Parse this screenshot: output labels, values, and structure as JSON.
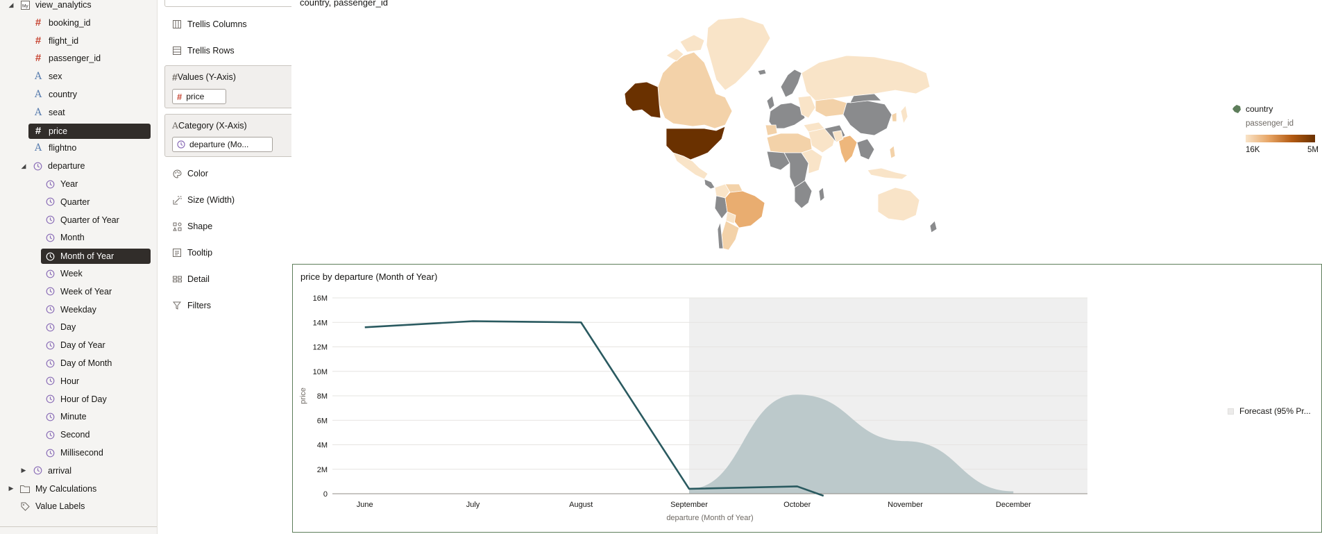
{
  "data_panel": {
    "root": {
      "label": "view_analytics",
      "icon": "database-icon"
    },
    "fields": [
      {
        "label": "booking_id",
        "type": "number"
      },
      {
        "label": "flight_id",
        "type": "number"
      },
      {
        "label": "passenger_id",
        "type": "number"
      },
      {
        "label": "sex",
        "type": "text"
      },
      {
        "label": "country",
        "type": "text"
      },
      {
        "label": "seat",
        "type": "text"
      },
      {
        "label": "price",
        "type": "number",
        "selected": true
      },
      {
        "label": "flightno",
        "type": "text"
      }
    ],
    "departure": {
      "label": "departure",
      "children": [
        "Year",
        "Quarter",
        "Quarter of Year",
        "Month",
        "Month of Year",
        "Week",
        "Week of Year",
        "Weekday",
        "Day",
        "Day of Year",
        "Day of Month",
        "Hour",
        "Hour of Day",
        "Minute",
        "Second",
        "Millisecond"
      ],
      "selected": "Month of Year"
    },
    "arrival": {
      "label": "arrival"
    },
    "my_calculations": {
      "label": "My Calculations"
    },
    "value_labels": {
      "label": "Value Labels"
    }
  },
  "grammar": {
    "dropdown_value": "Line",
    "trellis_columns": "Trellis Columns",
    "trellis_rows": "Trellis Rows",
    "values_title": "Values (Y-Axis)",
    "values_pill": "price",
    "category_title": "Category (X-Axis)",
    "category_pill": "departure (Mo...",
    "color": "Color",
    "size": "Size (Width)",
    "shape": "Shape",
    "tooltip": "Tooltip",
    "detail": "Detail",
    "filters": "Filters"
  },
  "map": {
    "title": "country, passenger_id",
    "legend_title": "country",
    "legend_sub": "passenger_id",
    "legend_min": "16K",
    "legend_max": "5M",
    "colors": {
      "min": "#f9e4c8",
      "max": "#6a3100",
      "no_data": "#8a8b8d"
    }
  },
  "line_chart": {
    "title": "price by departure (Month of Year)",
    "forecast_label": "Forecast (95% Pr...",
    "colors": {
      "line": "#2a5a60",
      "forecast_band": "#bcc9cb",
      "forecast_bg": "#efefef"
    }
  },
  "chart_data": {
    "type": "line",
    "title": "price by departure (Month of Year)",
    "xlabel": "departure (Month of Year)",
    "ylabel": "price",
    "categories": [
      "June",
      "July",
      "August",
      "September",
      "October",
      "November",
      "December"
    ],
    "ylim": [
      0,
      16000000
    ],
    "yticks": [
      0,
      2000000,
      4000000,
      6000000,
      8000000,
      10000000,
      12000000,
      14000000,
      16000000
    ],
    "ytick_labels": [
      "0",
      "2M",
      "4M",
      "6M",
      "8M",
      "10M",
      "12M",
      "14M",
      "16M"
    ],
    "series": [
      {
        "values": [
          13600000,
          14100000,
          14000000,
          400000,
          600000,
          null,
          null
        ]
      }
    ],
    "forecast": {
      "name": "Forecast (95% Pr...",
      "start_category": "September",
      "upper": [
        null,
        null,
        null,
        400000,
        8100000,
        4300000,
        200000
      ],
      "lower": [
        null,
        null,
        null,
        0,
        0,
        0,
        0
      ]
    },
    "grid": true,
    "legend": "right"
  }
}
